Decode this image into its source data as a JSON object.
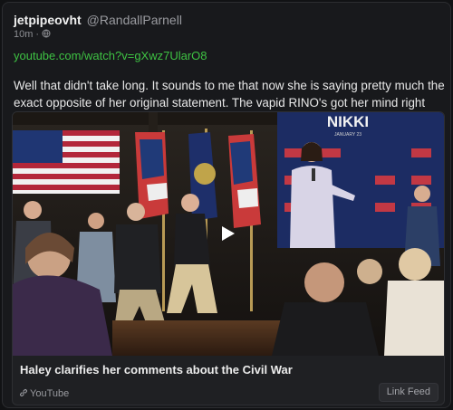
{
  "post": {
    "username": "jetpipeovht",
    "handle": "@RandallParnell",
    "time": "10m",
    "link": "youtube.com/watch?v=gXwz7UlarO8",
    "text": "Well that didn't take long. It sounds to me that now she is saying pretty much the exact opposite of her original statement. The vapid RINO's got her mind right now.",
    "visibility_icon": "globe-icon"
  },
  "card": {
    "title": "Haley clarifies her comments about the Civil War",
    "source": "YouTube",
    "feed_button": "Link Feed",
    "banner_text": "NIKKI",
    "banner_sub": "JANUARY 23",
    "sign_text": "NIKKI",
    "play_icon": "play-icon",
    "link_icon": "link-icon"
  },
  "colors": {
    "link": "#3ec243",
    "background": "#18191c"
  }
}
